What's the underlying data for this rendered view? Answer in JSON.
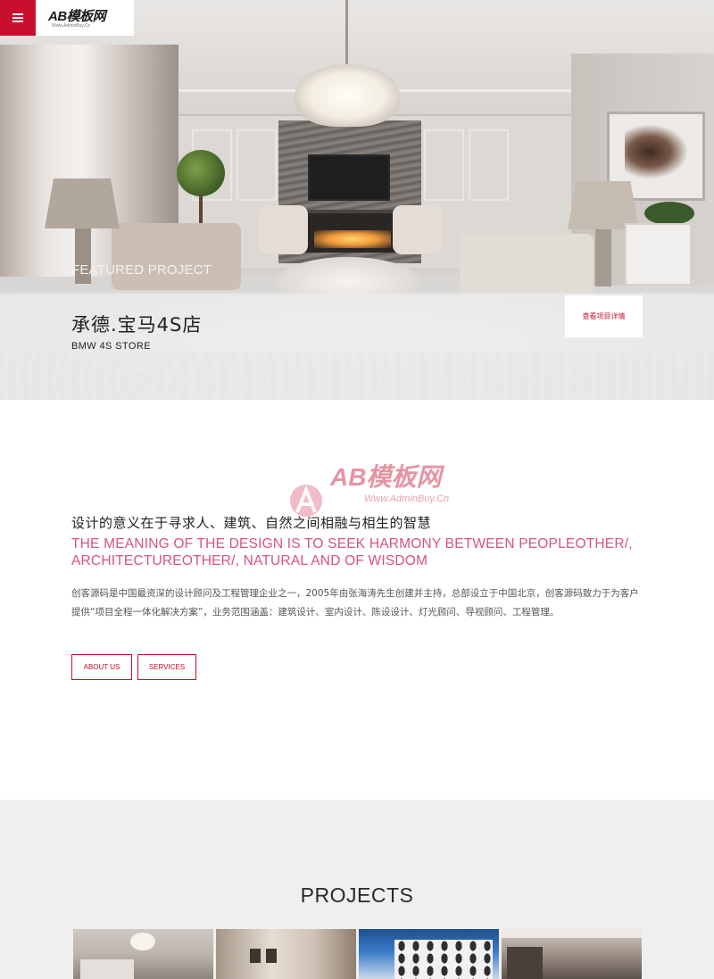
{
  "header": {
    "menu_icon": "hamburger-menu-icon",
    "logo_text": "AB模板网",
    "logo_subtext": "Www.AdminBuy.Cn"
  },
  "hero": {
    "tag": "FEATURED PROJECT",
    "title": "承德.宝马4S店",
    "subtitle": "BMW 4S STORE",
    "detail_button": "查看项目详情"
  },
  "watermark": {
    "text": "AB模板网",
    "url": "Www.AdminBuy.Cn"
  },
  "about": {
    "heading_zh": "设计的意义在于寻求人、建筑、自然之间相融与相生的智慧",
    "heading_en": "THE MEANING OF THE DESIGN IS TO SEEK HARMONY BETWEEN PEOPLEOTHER/, ARCHITECTUREOTHER/, NATURAL AND OF WISDOM",
    "description": "创客源码是中国最资深的设计顾问及工程管理企业之一，2005年由张海涛先生创建并主持，总部设立于中国北京，创客源码致力于为客户提供“项目全程一体化解决方案”，业务范围涵盖：建筑设计、室内设计、陈设设计、灯光顾问、导视顾问、工程管理。",
    "buttons": [
      {
        "label": "ABOUT US"
      },
      {
        "label": "SERVICES"
      }
    ]
  },
  "projects": {
    "title": "PROJECTS"
  },
  "colors": {
    "accent": "#c8102e",
    "accent_text": "#d9537a",
    "section_bg": "#efefef"
  }
}
